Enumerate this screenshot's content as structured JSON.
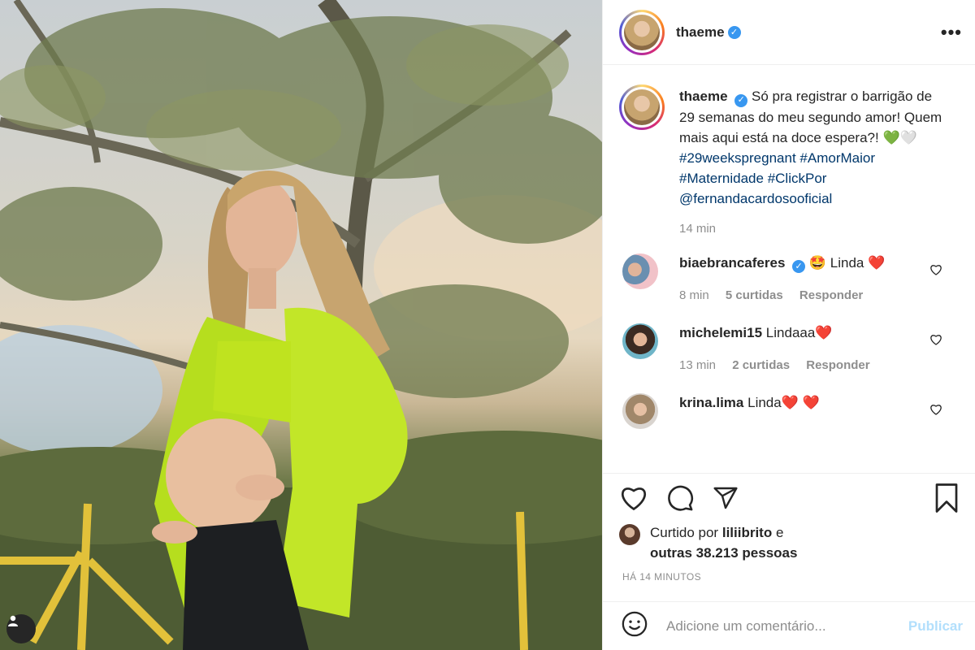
{
  "post": {
    "username": "thaeme",
    "verified_glyph": "✓",
    "more_label": "•••",
    "caption": {
      "username": "thaeme",
      "text": "Só pra registrar o barrigão de 29 semanas do meu segundo amor! Quem mais aqui está na doce espera?!",
      "emoji_green_heart": "💚",
      "emoji_white_heart": "🤍",
      "hashtags": [
        "#29weekspregnant",
        "#AmorMaior",
        "#Maternidade",
        "#ClickPor"
      ],
      "mention": "@fernandacardosooficial",
      "time": "14 min"
    }
  },
  "comments": [
    {
      "username": "biaebrancaferes",
      "verified": true,
      "text_emoji": "🤩",
      "text": "Linda",
      "text_suffix": "❤️",
      "time": "8 min",
      "likes": "5 curtidas",
      "reply": "Responder"
    },
    {
      "username": "michelemi15",
      "verified": false,
      "text": "Lindaaa",
      "text_suffix": "❤️",
      "time": "13 min",
      "likes": "2 curtidas",
      "reply": "Responder"
    },
    {
      "username": "krina.lima",
      "verified": false,
      "text": "Linda",
      "text_suffix": "❤️ ❤️"
    }
  ],
  "actions": {
    "liked_by_prefix": "Curtido por",
    "liked_by_user": "liliibrito",
    "liked_by_and": "e",
    "others": "outras 38.213 pessoas",
    "posted_ago": "HÁ 14 MINUTOS"
  },
  "add_comment": {
    "placeholder": "Adicione um comentário...",
    "publish_label": "Publicar"
  },
  "icons": {
    "like": "heart-icon",
    "comment": "comment-icon",
    "share": "paper-plane-icon",
    "save": "bookmark-icon",
    "emoji": "smiley-icon",
    "tag": "user-tag-icon"
  },
  "colors": {
    "link": "#00376b",
    "verified": "#3897f0",
    "muted": "#8e8e8e",
    "publish_disabled": "#b2dffc"
  }
}
